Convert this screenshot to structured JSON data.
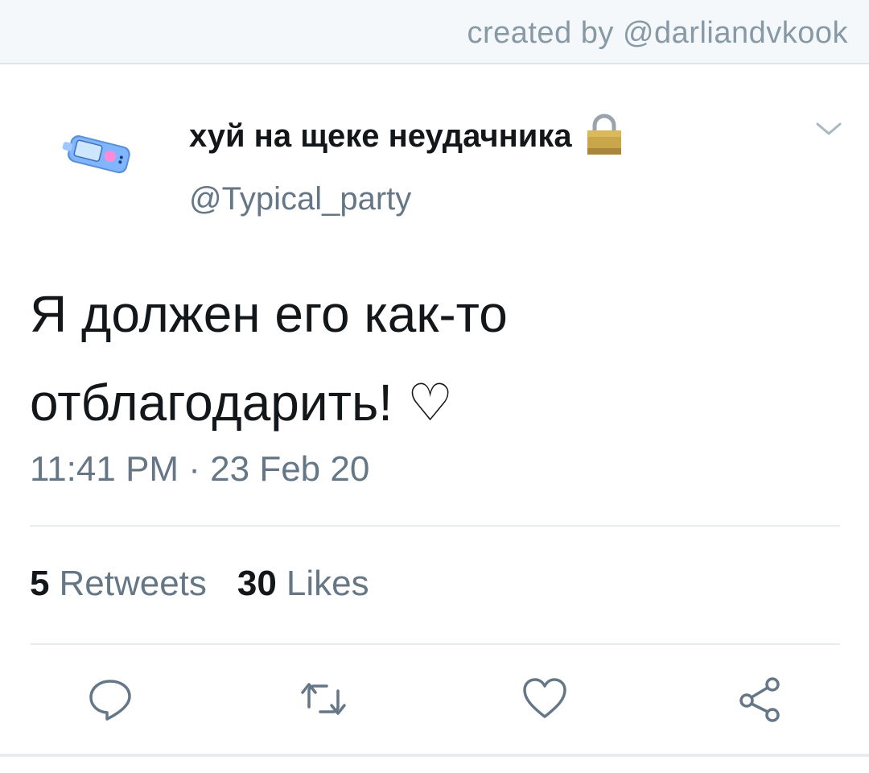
{
  "header": {
    "credit": "created by @darliandvkook"
  },
  "tweet": {
    "display_name": "хуй на щеке неудачника",
    "handle": "@Typical_party",
    "text_line1": "Я должен его как-то",
    "text_line2": "отблагодарить! ♡",
    "timestamp": "11:41 PM · 23 Feb 20",
    "retweets_count": "5",
    "retweets_label": "Retweets",
    "likes_count": "30",
    "likes_label": "Likes"
  },
  "icons": {
    "avatar": "phone-sticker-avatar",
    "lock": "lock-icon",
    "menu": "chevron-down-icon",
    "reply": "reply-icon",
    "retweet": "retweet-icon",
    "like": "heart-icon",
    "share": "share-icon"
  },
  "colors": {
    "primary_text": "#14171a",
    "secondary_text": "#657786",
    "divider": "#e6ecf0",
    "header_bg": "#f5f8fa"
  }
}
